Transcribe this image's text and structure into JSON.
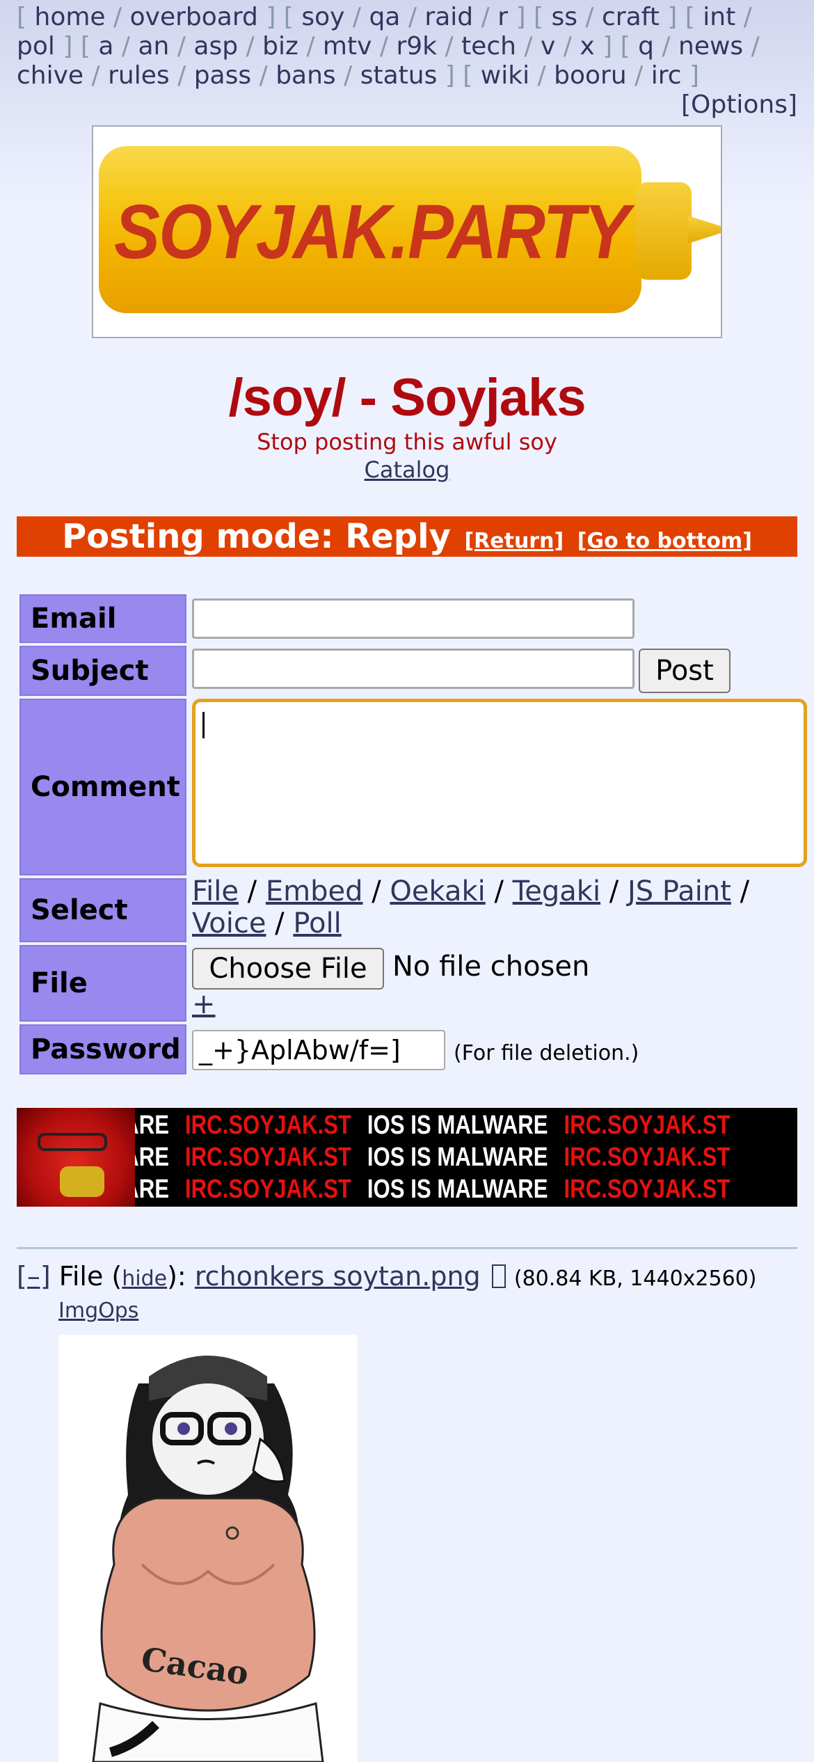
{
  "nav": {
    "row1": [
      "home",
      "overboard",
      "soy",
      "qa",
      "raid",
      "r",
      "ss",
      "craft",
      "int"
    ],
    "row2": [
      "pol",
      "a",
      "an",
      "asp",
      "biz",
      "mtv",
      "r9k",
      "tech",
      "v",
      "x",
      "q",
      "news"
    ],
    "row3": [
      "chive",
      "rules",
      "pass",
      "bans",
      "status",
      "wiki",
      "booru",
      "irc"
    ],
    "options": "[Options]"
  },
  "banner": {
    "text": "SOYJAK.PARTY"
  },
  "board": {
    "title": "/soy/ - Soyjaks",
    "subtitle": "Stop posting this awful soy",
    "catalog": "Catalog"
  },
  "posting_mode": {
    "label": "Posting mode: Reply",
    "return": "[Return]",
    "bottom": "[Go to bottom]"
  },
  "form": {
    "email_label": "Email",
    "subject_label": "Subject",
    "comment_label": "Comment",
    "select_label": "Select",
    "file_label": "File",
    "password_label": "Password",
    "email_value": "",
    "subject_value": "",
    "post_button": "Post",
    "select_links": [
      "File",
      "Embed",
      "Oekaki",
      "Tegaki",
      "JS Paint",
      "Voice",
      "Poll"
    ],
    "choose_file": "Choose File",
    "no_file": "No file chosen",
    "plus": "+",
    "password_value": "_+}AplAbw/f=]",
    "password_note": "(For file deletion.)"
  },
  "ad": {
    "text_white": "IOS IS MALWARE",
    "text_red": "IRC.SOYJAK.ST",
    "partial_white": "LWARE"
  },
  "file": {
    "collapse": "[–]",
    "label": "File",
    "hide": "hide",
    "filename": "rchonkers soytan.png",
    "info": "(80.84 KB, 1440x2560)",
    "imgops": "ImgOps"
  },
  "thumb": {
    "belly_text": "Cacao"
  },
  "colors": {
    "accent_red": "#af0a0f",
    "posting_bar": "#e04000",
    "label_bg": "#9988ee",
    "focus_border": "#e3a11c",
    "link": "#34345c"
  }
}
